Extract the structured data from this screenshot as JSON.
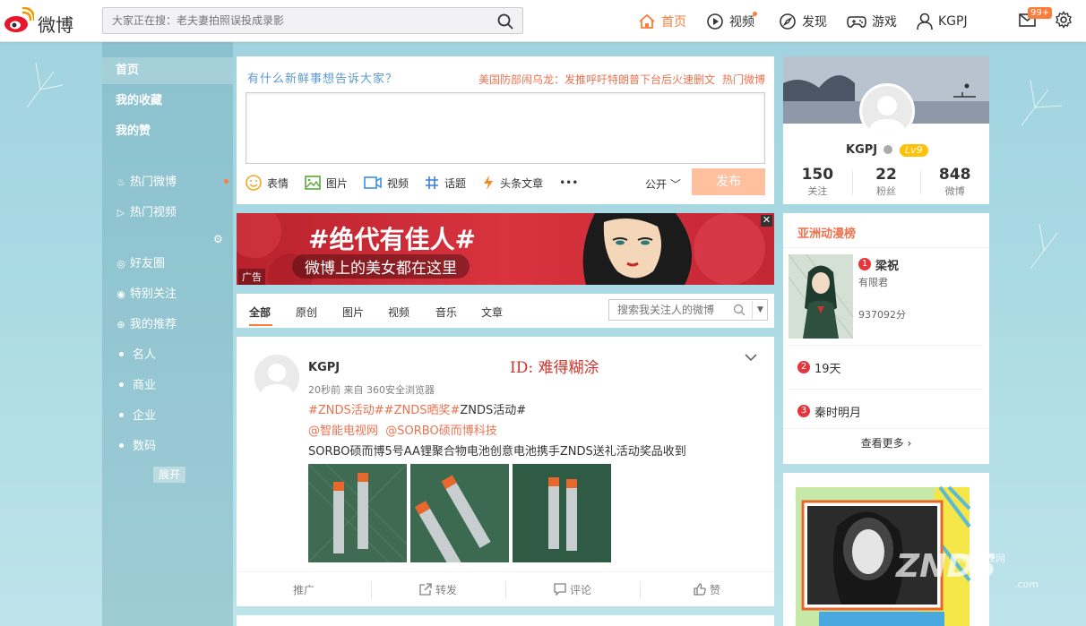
{
  "brand": {
    "name": "微博",
    "accent": "#fa7d3c"
  },
  "search": {
    "placeholder": "大家正在搜：老夫妻拍照误投成录影"
  },
  "nav": {
    "home": "首页",
    "video": "视频",
    "discover": "发现",
    "game": "游戏",
    "user": "KGPJ",
    "messages_badge": "99+"
  },
  "sidebar": {
    "items": [
      "首页",
      "我的收藏",
      "我的赞"
    ],
    "hot": [
      "热门微博",
      "热门视频"
    ],
    "groups": [
      "好友圈",
      "特别关注",
      "我的推荐"
    ],
    "sub": [
      "名人",
      "商业",
      "企业",
      "数码"
    ],
    "expand": "展开"
  },
  "composer": {
    "title": "有什么新鲜事想告诉大家？",
    "hot_news": "美国防部闹乌龙：发推呼吁特朗普下台后火速删文",
    "hot_link": "热门微博",
    "tools": [
      "表情",
      "图片",
      "视频",
      "话题",
      "头条文章"
    ],
    "more": "•••",
    "visibility": "公开",
    "publish": "发布"
  },
  "ad": {
    "title": "#绝代有佳人#",
    "subtitle": "微博上的美女都在这里",
    "tag": "广告",
    "close": "✕"
  },
  "feed_tabs": {
    "tabs": [
      "全部",
      "原创",
      "图片",
      "视频",
      "音乐",
      "文章"
    ],
    "search_placeholder": "搜索我关注人的微博"
  },
  "post": {
    "author": "KGPJ",
    "watermark_id": "ID: 难得糊涂",
    "meta": "20秒前 来自 360安全浏览器",
    "line1_links": "#ZNDS活动##ZNDS晒奖#",
    "line1_rest": "ZNDS活动#",
    "line2_mention1": "@智能电视网",
    "line2_mention2": "@SORBO硕而博科技",
    "line3": "SORBO硕而博5号AA锂聚合物电池创意电池携手ZNDS送礼活动奖品收到",
    "actions": [
      "推广",
      "转发",
      "评论",
      "赞"
    ]
  },
  "profile": {
    "name": "KGPJ",
    "level": "Lv9",
    "stats": [
      {
        "num": "150",
        "label": "关注"
      },
      {
        "num": "22",
        "label": "粉丝"
      },
      {
        "num": "848",
        "label": "微博"
      }
    ]
  },
  "ranking": {
    "title": "亚洲动漫榜",
    "first": {
      "rank": "1",
      "name": "梁祝",
      "sub": "有限君",
      "score": "937092分"
    },
    "second": {
      "rank": "2",
      "name": "19天"
    },
    "third": {
      "rank": "3",
      "name": "秦时明月"
    },
    "more": "查看更多"
  },
  "watermark": {
    "logo": "ZNDS",
    "sub": "智能电视网",
    "com": ".com"
  }
}
